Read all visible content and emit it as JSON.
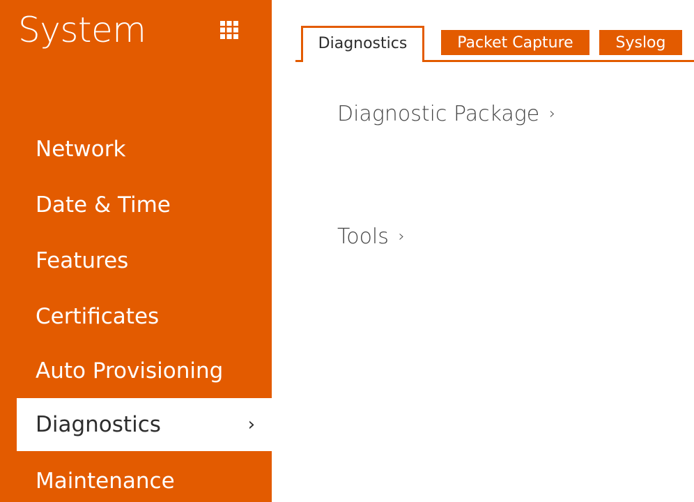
{
  "sidebar": {
    "title": "System",
    "menu_icon": "grid-icon",
    "items": [
      {
        "label": "Network",
        "active": false
      },
      {
        "label": "Date & Time",
        "active": false
      },
      {
        "label": "Features",
        "active": false
      },
      {
        "label": "Certificates",
        "active": false
      },
      {
        "label": "Auto Provisioning",
        "active": false
      },
      {
        "label": "Diagnostics",
        "active": true,
        "chevron": "›"
      },
      {
        "label": "Maintenance",
        "active": false
      }
    ]
  },
  "tabs": [
    {
      "label": "Diagnostics",
      "active": true
    },
    {
      "label": "Packet Capture",
      "active": false
    },
    {
      "label": "Syslog",
      "active": false
    }
  ],
  "sections": [
    {
      "label": "Diagnostic Package",
      "chevron": "›"
    },
    {
      "label": "Tools",
      "chevron": "›"
    }
  ],
  "colors": {
    "accent": "#e35b00",
    "active_text": "#2d2d2d",
    "body_text": "#454545"
  }
}
